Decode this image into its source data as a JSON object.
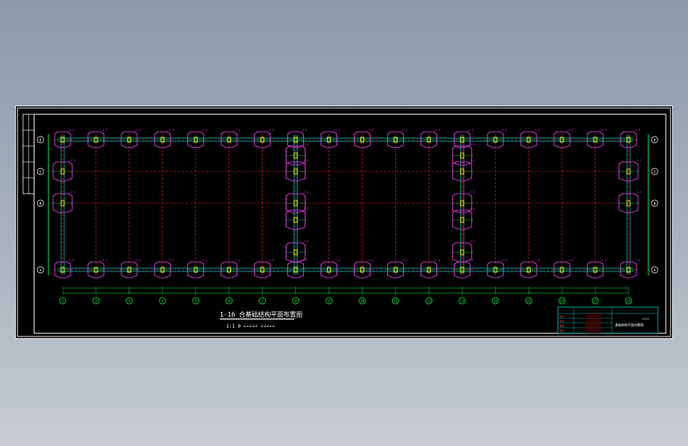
{
  "drawing": {
    "title": "1-16 合基础结构平面布置图",
    "scale_note": "1:1 0   ∠∠∠∠∠ ∠∠∠∠∠",
    "column_axes": [
      "1",
      "2",
      "3",
      "4",
      "5",
      "6",
      "7",
      "8",
      "9",
      "10",
      "11",
      "12",
      "13",
      "14",
      "15",
      "16",
      "17",
      "18"
    ],
    "row_axes": [
      "A",
      "B",
      "C",
      "D"
    ],
    "foundation_mark": "J-1",
    "title_block": {
      "drawing_name": "基础结构平面布置图",
      "rows": [
        "设计",
        "校对",
        "审核",
        "审定",
        "日期"
      ]
    }
  },
  "colors": {
    "sheet_background": "#000000",
    "beam": "#00c8c8",
    "grid": "#ff2020",
    "footing": "#ff40ff",
    "pedestal": "#ffff00",
    "dimension": "#00ff40",
    "border": "#ffffff"
  }
}
